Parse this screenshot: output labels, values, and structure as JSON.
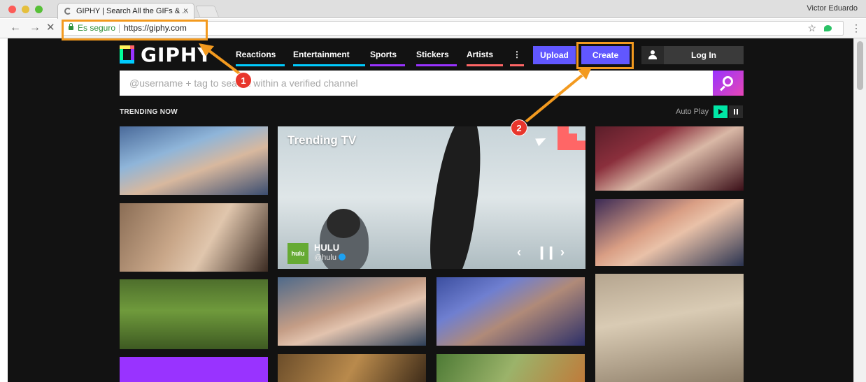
{
  "browser": {
    "tab_title": "GIPHY | Search All the GIFs & ...",
    "tab_close": "×",
    "profile_name": "Victor Eduardo",
    "secure_label": "Es seguro",
    "url": "https://giphy.com",
    "back": "←",
    "forward": "→",
    "stop": "✕",
    "star": "☆",
    "menu": "⋮"
  },
  "giphy": {
    "logo": "GIPHY",
    "nav": [
      "Reactions",
      "Entertainment",
      "Sports",
      "Stickers",
      "Artists",
      "⋮"
    ],
    "upload": "Upload",
    "create": "Create",
    "login": "Log In",
    "search_placeholder": "@username + tag to search within a verified channel",
    "trending": "TRENDING NOW",
    "autoplay": "Auto Play",
    "featured": {
      "title": "Trending TV",
      "channel": "HULU",
      "handle": "@hulu",
      "logo": "hulu",
      "prev": "‹",
      "pause": "❙❙",
      "next": "›"
    }
  },
  "annotations": [
    "1",
    "2"
  ],
  "colors": {
    "annotation": "#f39a1f",
    "badge": "#e8362c",
    "accent": "#6157ff",
    "page_bg": "#121212"
  }
}
